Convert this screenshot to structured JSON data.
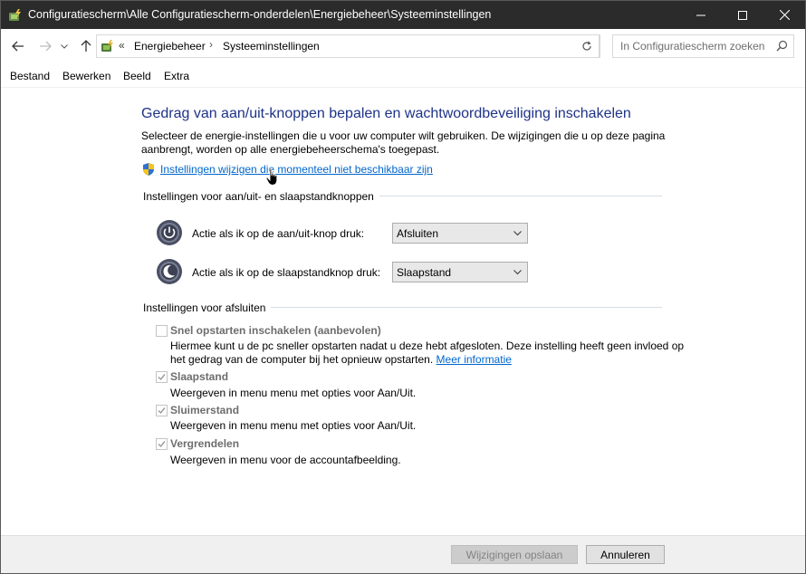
{
  "window": {
    "title": "Configuratiescherm\\Alle Configuratiescherm-onderdelen\\Energiebeheer\\Systeeminstellingen"
  },
  "address": {
    "overflow": "«",
    "crumbs": [
      "Energiebeheer",
      "Systeeminstellingen"
    ],
    "separator": "›"
  },
  "search": {
    "placeholder": "In Configuratiescherm zoeken"
  },
  "menu": [
    "Bestand",
    "Bewerken",
    "Beeld",
    "Extra"
  ],
  "main": {
    "heading": "Gedrag van aan/uit-knoppen bepalen en wachtwoordbeveiliging inschakelen",
    "intro": "Selecteer de energie-instellingen die u voor uw computer wilt gebruiken. De wijzigingen die u op deze pagina aanbrengt, worden op alle energiebeheerschema's toegepast.",
    "change_link": "Instellingen wijzigen die momenteel niet beschikbaar zijn",
    "buttons_section": {
      "title": "Instellingen voor aan/uit- en slaapstandknoppen",
      "rows": [
        {
          "label": "Actie als ik op de aan/uit-knop druk:",
          "value": "Afsluiten"
        },
        {
          "label": "Actie als ik op de slaapstandknop druk:",
          "value": "Slaapstand"
        }
      ]
    },
    "shutdown_section": {
      "title": "Instellingen voor afsluiten",
      "items": [
        {
          "title": "Snel opstarten inschakelen (aanbevolen)",
          "checked": false,
          "desc": "Hiermee kunt u de pc sneller opstarten nadat u deze hebt afgesloten. Deze instelling heeft geen invloed op het gedrag van de computer bij het opnieuw opstarten.",
          "link": "Meer informatie"
        },
        {
          "title": "Slaapstand",
          "checked": true,
          "desc": "Weergeven in menu menu met opties voor Aan/Uit."
        },
        {
          "title": "Sluimerstand",
          "checked": true,
          "desc": "Weergeven in menu menu met opties voor Aan/Uit."
        },
        {
          "title": "Vergrendelen",
          "checked": true,
          "desc": "Weergeven in menu voor de accountafbeelding."
        }
      ]
    }
  },
  "footer": {
    "save": "Wijzigingen opslaan",
    "cancel": "Annuleren"
  },
  "colors": {
    "titlebar": "#2b2b2b",
    "heading": "#1e3287",
    "link": "#0066cc",
    "footer": "#f0f0f0"
  }
}
